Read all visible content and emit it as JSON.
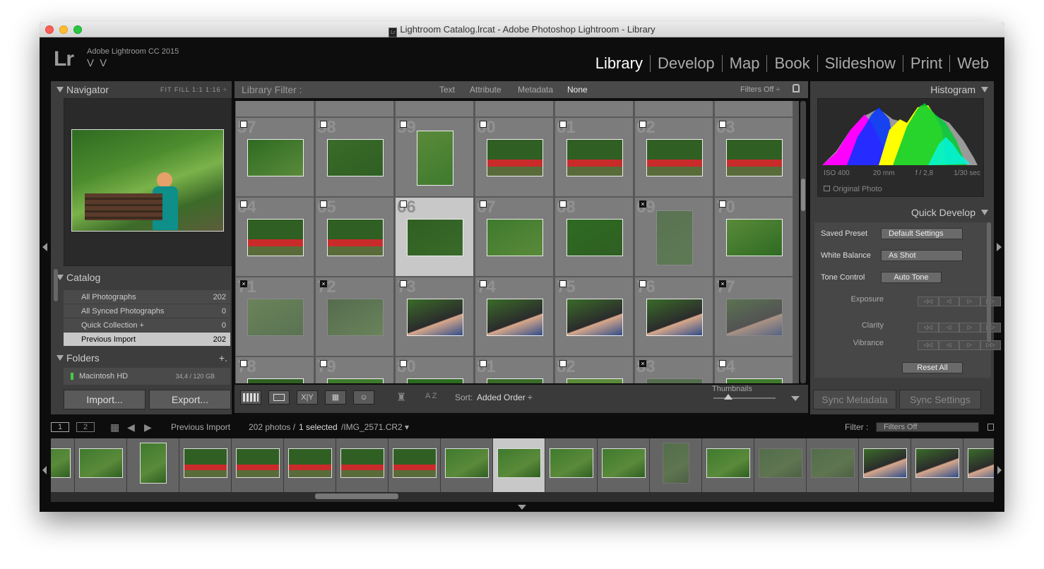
{
  "window": {
    "title": "Lightroom Catalog.lrcat - Adobe Photoshop Lightroom - Library"
  },
  "identity": {
    "logo": "Lr",
    "product": "Adobe Lightroom CC 2015",
    "user": "V V"
  },
  "modules": [
    "Library",
    "Develop",
    "Map",
    "Book",
    "Slideshow",
    "Print",
    "Web"
  ],
  "navigator": {
    "title": "Navigator",
    "options": "FIT  FILL  1:1  1:16 ÷"
  },
  "catalog": {
    "title": "Catalog",
    "items": [
      {
        "label": "All Photographs",
        "count": "202"
      },
      {
        "label": "All Synced Photographs",
        "count": "0"
      },
      {
        "label": "Quick Collection  +",
        "count": "0"
      },
      {
        "label": "Previous Import",
        "count": "202"
      }
    ]
  },
  "folders": {
    "title": "Folders",
    "add": "+.",
    "disk": "Macintosh HD",
    "size": "34,4 / 120 GB"
  },
  "buttons": {
    "import": "Import...",
    "export": "Export..."
  },
  "filter": {
    "label": "Library Filter :",
    "tabs": [
      "Text",
      "Attribute",
      "Metadata",
      "None"
    ],
    "state": "Filters Off ÷"
  },
  "grid": {
    "rows": [
      {
        "numbers": [
          "",
          "",
          "",
          "",
          "",
          "",
          ""
        ]
      },
      {
        "numbers": [
          "57",
          "58",
          "59",
          "60",
          "61",
          "62",
          "63"
        ]
      },
      {
        "numbers": [
          "64",
          "65",
          "66",
          "67",
          "68",
          "69",
          "70"
        ]
      },
      {
        "numbers": [
          "71",
          "72",
          "73",
          "74",
          "75",
          "76",
          "77"
        ]
      },
      {
        "numbers": [
          "78",
          "79",
          "80",
          "81",
          "82",
          "83",
          "84"
        ]
      }
    ]
  },
  "toolbar": {
    "sort_label": "Sort:",
    "sort_value": "Added Order ÷",
    "thumbs_label": "Thumbnails",
    "az": "A Z"
  },
  "histogram": {
    "title": "Histogram",
    "iso": "ISO 400",
    "focal": "20 mm",
    "aperture": "f / 2,8",
    "shutter": "1/30 sec",
    "original": "Original Photo"
  },
  "quick_develop": {
    "title": "Quick Develop",
    "saved_preset": {
      "label": "Saved Preset",
      "value": "Default Settings"
    },
    "white_balance": {
      "label": "White Balance",
      "value": "As Shot"
    },
    "tone_control": {
      "label": "Tone Control",
      "value": "Auto Tone"
    },
    "exposure": "Exposure",
    "clarity": "Clarity",
    "vibrance": "Vibrance",
    "reset": "Reset All"
  },
  "sync": {
    "metadata": "Sync Metadata",
    "settings": "Sync Settings"
  },
  "status": {
    "page1": "1",
    "page2": "2",
    "source": "Previous Import",
    "count_prefix": "202 photos /",
    "selected": "1 selected",
    "file": "/IMG_2571.CR2 ▾",
    "filter_label": "Filter :",
    "filter_value": "Filters Off"
  },
  "colors": {
    "accent": "#ffffff",
    "panel": "#3d3d3d",
    "grid": "#7c7c7c",
    "selected": "#c8c8c8"
  }
}
